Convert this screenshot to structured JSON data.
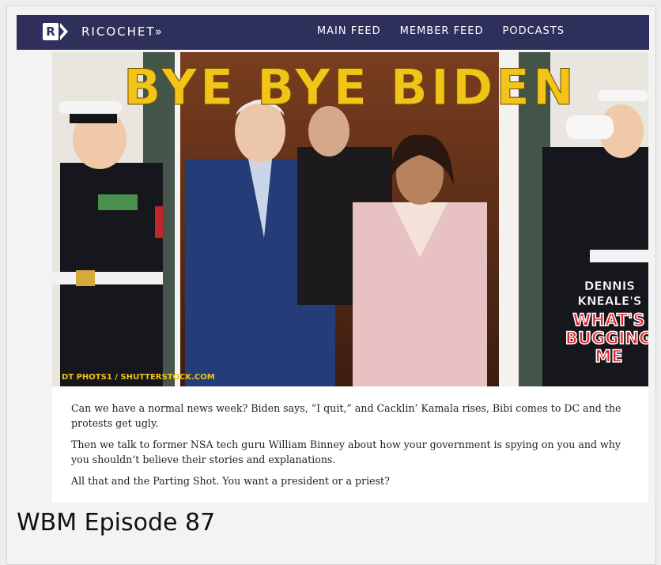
{
  "header": {
    "logo_letter": "R",
    "brand": "RICOCHET»",
    "nav": [
      "MAIN FEED",
      "MEMBER FEED",
      "PODCASTS"
    ]
  },
  "hero": {
    "headline": "BYE BYE BIDEN",
    "credit": "DT PHOTS1 / SHUTTERSTOCK.COM",
    "show_line1": "DENNIS",
    "show_line2": "KNEALE'S",
    "show_line3": "WHAT'S",
    "show_line4": "BUGGING",
    "show_line5": "ME"
  },
  "content": {
    "paragraphs": [
      "Can we have a normal news week? Biden says, “I quit,” and Cacklin’ Kamala rises, Bibi comes to DC and the protests get ugly.",
      "Then we talk to former NSA tech guru William Binney about how your government is spying on you and why you shouldn’t believe their stories and explanations.",
      "All that and the Parting Shot. You want a president or a priest?"
    ]
  },
  "episode": {
    "title": "WBM Episode 87"
  },
  "colors": {
    "header_bg": "#2f2f5c",
    "headline": "#f2c318",
    "show_red": "#e0232e"
  }
}
